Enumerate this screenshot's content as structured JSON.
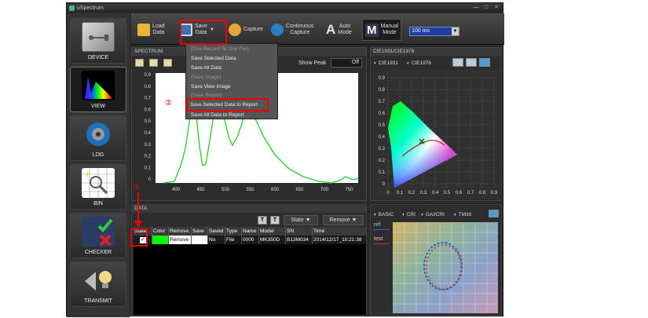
{
  "window": {
    "title": "uSpectrum",
    "minimize": "—",
    "maximize": "□",
    "close": "×"
  },
  "sidebar": {
    "items": [
      {
        "label": "DEVICE"
      },
      {
        "label": "VIEW"
      },
      {
        "label": "LOG"
      },
      {
        "label": "BIN"
      },
      {
        "label": "CHECKER"
      },
      {
        "label": "TRANSMIT"
      }
    ]
  },
  "toolbar": {
    "load_label": "Load\nData",
    "save_label": "Save\nData",
    "capture_label": "Capture",
    "continuous_label": "Continuous\nCapture",
    "auto_label": "Auto\nMode",
    "manual_label": "Manual\nMode",
    "exposure_value": "100 ms"
  },
  "save_menu": {
    "items": [
      {
        "label": "[One Record To One File]",
        "disabled": true
      },
      {
        "label": "Save Selected Data",
        "disabled": false
      },
      {
        "label": "Save All Data",
        "disabled": false
      },
      {
        "label": "[Save Image]",
        "disabled": true
      },
      {
        "label": "Save View Image",
        "disabled": false
      },
      {
        "label": "[Save Report]",
        "disabled": true
      },
      {
        "label": "Save Selected Data to Report",
        "disabled": false
      },
      {
        "label": "Save All Data to Report",
        "disabled": false
      }
    ]
  },
  "spectrum": {
    "header": "SPECTRUM",
    "show_peak_label": "Show Peak",
    "show_peak_toggle": "Off",
    "y_ticks": [
      "0.9",
      "0.8",
      "0.7",
      "0.6",
      "0.5",
      "0.4",
      "0.3",
      "0.2",
      "0.1",
      "0"
    ],
    "x_ticks": [
      "400",
      "450",
      "500",
      "550",
      "600",
      "650",
      "700",
      "750"
    ]
  },
  "cie": {
    "header": "CIE1931/CIE1976",
    "tab1": "CIE1931",
    "tab2": "CIE1976",
    "y_ticks": [
      "0.9",
      "0.8",
      "0.7",
      "0.6",
      "0.5",
      "0.4",
      "0.3",
      "0.2",
      "0.1",
      "0"
    ],
    "x_ticks": [
      "0",
      "0.1",
      "0.2",
      "0.3",
      "0.4",
      "0.5",
      "0.6",
      "0.7",
      "0.8"
    ],
    "x_end": "0.9"
  },
  "data_panel": {
    "header": "DATA",
    "state_btn": "State ▼",
    "remove_btn": "Remove ▼",
    "columns": [
      "State",
      "Color",
      "Remove",
      "Save",
      "Saved",
      "Type",
      "Name",
      "Model",
      "SN",
      "Time"
    ],
    "rows": [
      {
        "state": "✓",
        "remove": "Remove",
        "saved": "No",
        "type": "File",
        "name": "0000",
        "model": "MK350D",
        "sn": "B13M034",
        "time": "2014/12/17_10:21:38"
      }
    ]
  },
  "cri_panel": {
    "tabs": [
      "BASIC",
      "CRI",
      "GAI/CRI",
      "TM30"
    ],
    "legend": [
      "ref",
      "test"
    ]
  },
  "annotations": {
    "callout1": "①",
    "callout2": "②"
  },
  "colors": {
    "accent_red": "#e00000",
    "spectrum_line": "#33cc33",
    "sample_color": "#00ff00"
  }
}
